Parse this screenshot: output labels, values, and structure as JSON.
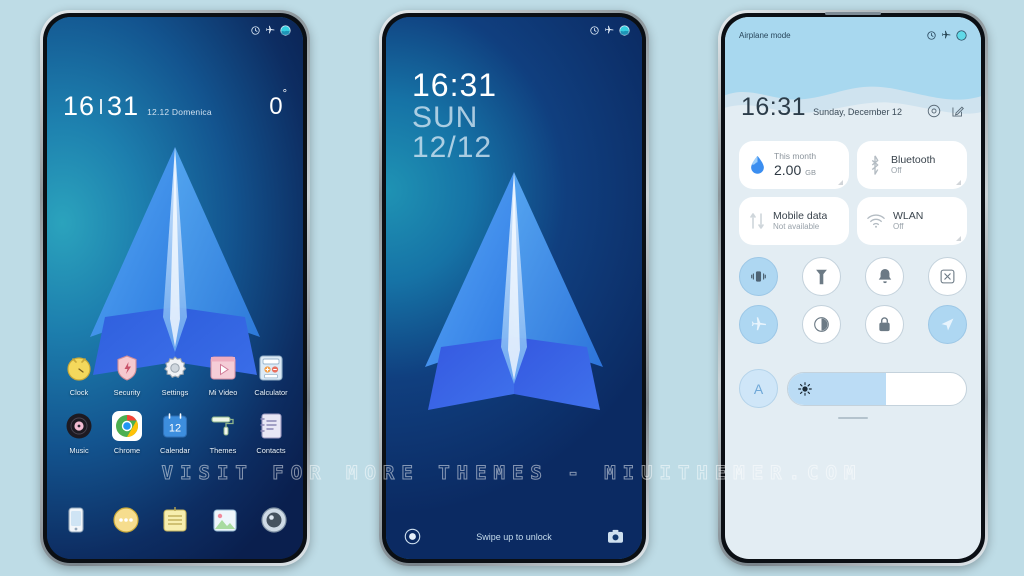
{
  "watermark": "VISIT FOR MORE THEMES - MIUITHEMER.COM",
  "colors": {
    "page_background": "#bedce6",
    "accent_blue": "#3b82f6",
    "shade_sky": "#a8d8ef",
    "shade_background": "#e3edf3",
    "toggle_active": "#aed7f2"
  },
  "phone_home": {
    "status_bar": {
      "alarm_icon": "alarm-clock-icon",
      "airplane_icon": "airplane-icon",
      "battery_icon": "battery-circle-icon"
    },
    "clock_widget": {
      "hours": "16",
      "minutes": "31",
      "date": "12.12 Domenica",
      "temperature": "0",
      "degree": "°"
    },
    "apps_row1": [
      {
        "label": "Clock",
        "icon": "clock-app-icon"
      },
      {
        "label": "Security",
        "icon": "security-shield-icon"
      },
      {
        "label": "Settings",
        "icon": "settings-gear-icon"
      },
      {
        "label": "Mi Video",
        "icon": "mi-video-icon"
      },
      {
        "label": "Calculator",
        "icon": "calculator-icon"
      }
    ],
    "apps_row2": [
      {
        "label": "Music",
        "icon": "music-vinyl-icon"
      },
      {
        "label": "Chrome",
        "icon": "chrome-icon"
      },
      {
        "label": "Calendar",
        "icon": "calendar-icon",
        "day": "12"
      },
      {
        "label": "Themes",
        "icon": "themes-roller-icon"
      },
      {
        "label": "Contacts",
        "icon": "contacts-icon"
      }
    ],
    "dock": [
      {
        "label": "Phone",
        "icon": "phone-icon"
      },
      {
        "label": "Messages",
        "icon": "messages-icon"
      },
      {
        "label": "Notes",
        "icon": "notes-icon"
      },
      {
        "label": "Gallery",
        "icon": "gallery-icon"
      },
      {
        "label": "Camera",
        "icon": "camera-icon"
      }
    ]
  },
  "phone_lock": {
    "status_bar": {
      "alarm_icon": "alarm-clock-icon",
      "airplane_icon": "airplane-icon",
      "battery_icon": "battery-circle-icon"
    },
    "time": "16:31",
    "weekday": "SUN",
    "date": "12/12",
    "hint": "Swipe up to unlock",
    "flashlight_icon": "flashlight-icon",
    "camera_icon": "camera-icon"
  },
  "phone_shade": {
    "status_text": "Airplane mode",
    "status_icons": {
      "alarm_icon": "alarm-clock-icon",
      "airplane_icon": "airplane-icon",
      "battery_icon": "battery-circle-icon"
    },
    "time": "16:31",
    "date": "Sunday, December 12",
    "settings_icon": "settings-gear-icon",
    "edit_icon": "edit-pencil-icon",
    "cards": [
      {
        "name": "data-usage-card",
        "icon": "water-drop-icon",
        "title": "This month",
        "value": "2.00",
        "unit": "GB",
        "type": "big"
      },
      {
        "name": "bluetooth-card",
        "icon": "bluetooth-icon",
        "title": "Bluetooth",
        "status": "Off",
        "type": "toggle"
      },
      {
        "name": "mobile-data-card",
        "icon": "mobile-data-icon",
        "title": "Mobile data",
        "status": "Not available",
        "type": "toggle"
      },
      {
        "name": "wlan-card",
        "icon": "wifi-icon",
        "title": "WLAN",
        "status": "Off",
        "type": "toggle"
      }
    ],
    "toggles_row1": [
      {
        "name": "vibrate-toggle",
        "icon": "vibrate-icon",
        "active": true
      },
      {
        "name": "flashlight-toggle",
        "icon": "flashlight-icon",
        "active": false
      },
      {
        "name": "ringtone-toggle",
        "icon": "bell-icon",
        "active": false
      },
      {
        "name": "screenshot-toggle",
        "icon": "screenshot-icon",
        "active": false
      }
    ],
    "toggles_row2": [
      {
        "name": "airplane-toggle",
        "icon": "airplane-icon",
        "active": true
      },
      {
        "name": "dark-mode-toggle",
        "icon": "contrast-circle-icon",
        "active": false
      },
      {
        "name": "lock-rotation-toggle",
        "icon": "lock-icon",
        "active": false
      },
      {
        "name": "location-toggle",
        "icon": "location-arrow-icon",
        "active": true
      }
    ],
    "brightness": {
      "auto_label": "A",
      "auto_active": true,
      "slider_icon": "brightness-sun-icon",
      "level_percent": 55
    }
  }
}
